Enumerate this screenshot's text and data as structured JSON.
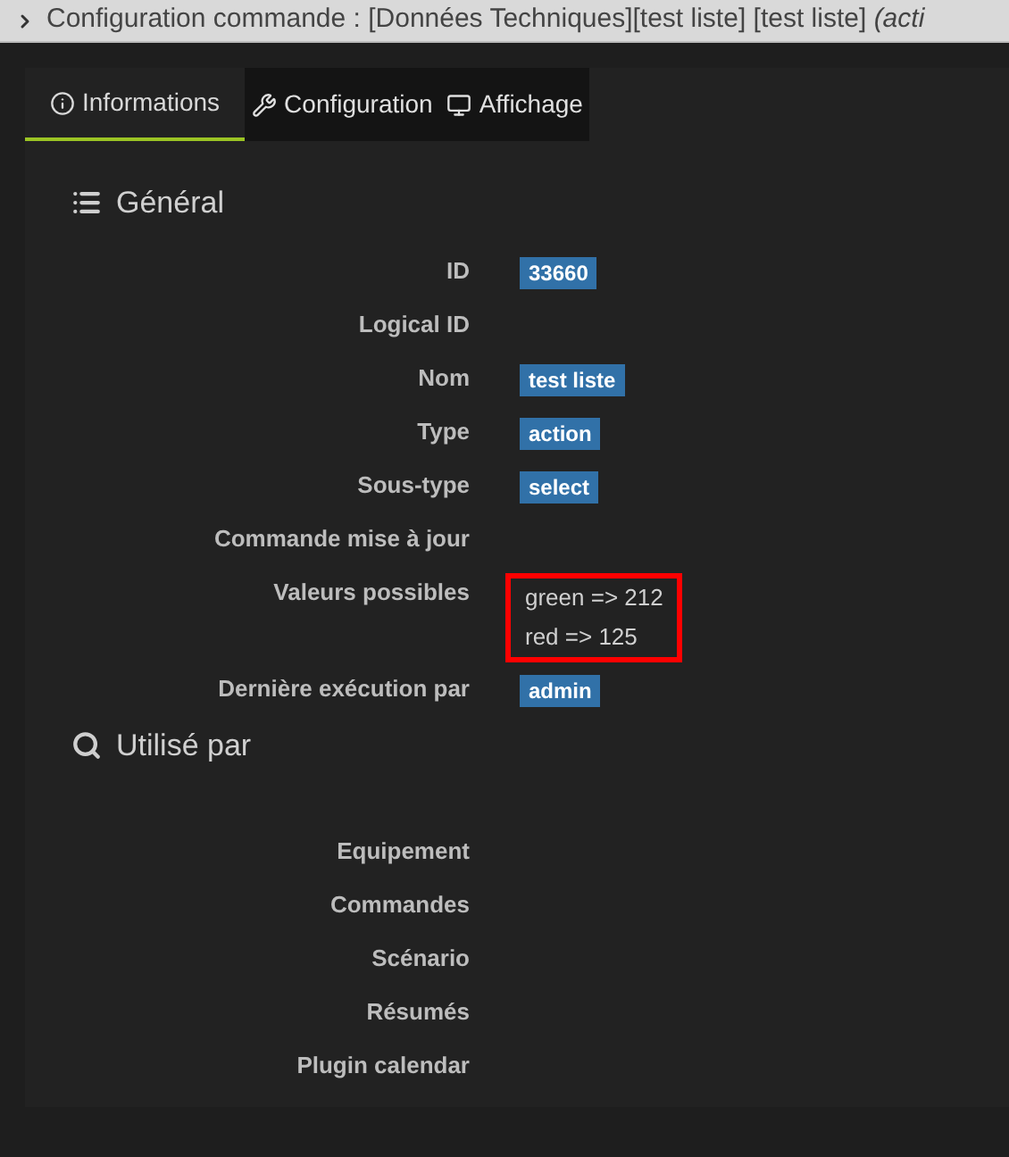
{
  "window": {
    "title": "Configuration commande : [Données Techniques][test liste] [test liste] *(acti*"
  },
  "tabs": [
    {
      "label": "Informations",
      "selected": true
    },
    {
      "label": "Configuration",
      "selected": false
    },
    {
      "label": "Affichage",
      "selected": false
    }
  ],
  "sections": [
    {
      "title": "Général",
      "rows": [
        {
          "label": "ID",
          "kind": "badge",
          "value": "33660"
        },
        {
          "label": "Logical ID",
          "kind": "empty"
        },
        {
          "label": "Nom",
          "kind": "badge",
          "value": "test liste"
        },
        {
          "label": "Type",
          "kind": "badge",
          "value": "action"
        },
        {
          "label": "Sous-type",
          "kind": "badge",
          "value": "select"
        },
        {
          "label": "Commande mise à jour",
          "kind": "empty"
        },
        {
          "label": "Valeurs possibles",
          "kind": "list",
          "highlighted": true,
          "values": [
            "green => 212",
            "red => 125"
          ]
        },
        {
          "label": "Dernière exécution par",
          "kind": "badge",
          "value": "admin"
        }
      ]
    },
    {
      "title": "Utilisé par",
      "rows": [
        {
          "label": "Equipement",
          "kind": "empty"
        },
        {
          "label": "Commandes",
          "kind": "empty"
        },
        {
          "label": "Scénario",
          "kind": "empty"
        },
        {
          "label": "Résumés",
          "kind": "empty"
        },
        {
          "label": "Plugin calendar",
          "kind": "empty"
        }
      ]
    }
  ]
}
